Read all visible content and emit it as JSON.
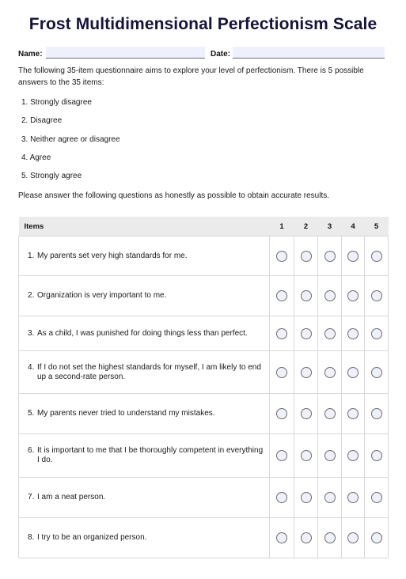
{
  "title": "Frost Multidimensional Perfectionism Scale",
  "fields": {
    "name_label": "Name:",
    "name_value": "",
    "date_label": "Date:",
    "date_value": ""
  },
  "intro": "The following 35-item questionnaire aims to explore your level of perfectionism. There is 5 possible answers to the 35 items:",
  "options": [
    "1. Strongly disagree",
    "2. Disagree",
    "3. Neither agree or disagree",
    "4. Agree",
    "5. Strongly agree"
  ],
  "instruction": "Please answer the following questions as honestly as possible to obtain accurate results.",
  "table": {
    "headers": [
      "Items",
      "1",
      "2",
      "3",
      "4",
      "5"
    ],
    "rows": [
      {
        "num": "1.",
        "text": "My parents set very high standards for me.",
        "selected": null
      },
      {
        "num": "2.",
        "text": "Organization is very important to me.",
        "selected": null
      },
      {
        "num": "3.",
        "text": "As a child, I was punished for doing things less than perfect.",
        "selected": null
      },
      {
        "num": "4.",
        "text": "If I do not set the highest standards for myself, I am likely to end up a second-rate person.",
        "selected": null
      },
      {
        "num": "5.",
        "text": "My parents never tried to understand my mistakes.",
        "selected": null
      },
      {
        "num": "6.",
        "text": "It is important to me that I be thoroughly competent in everything I do.",
        "selected": null
      },
      {
        "num": "7.",
        "text": "I am a neat person.",
        "selected": null
      },
      {
        "num": "8.",
        "text": "I try to be an organized person.",
        "selected": null
      }
    ]
  },
  "colors": {
    "title": "#14143c",
    "field_fill": "#eef0fb",
    "header_fill": "#ebebeb",
    "radio_fill": "#eef0fb",
    "grid": "#d9d9d9"
  }
}
